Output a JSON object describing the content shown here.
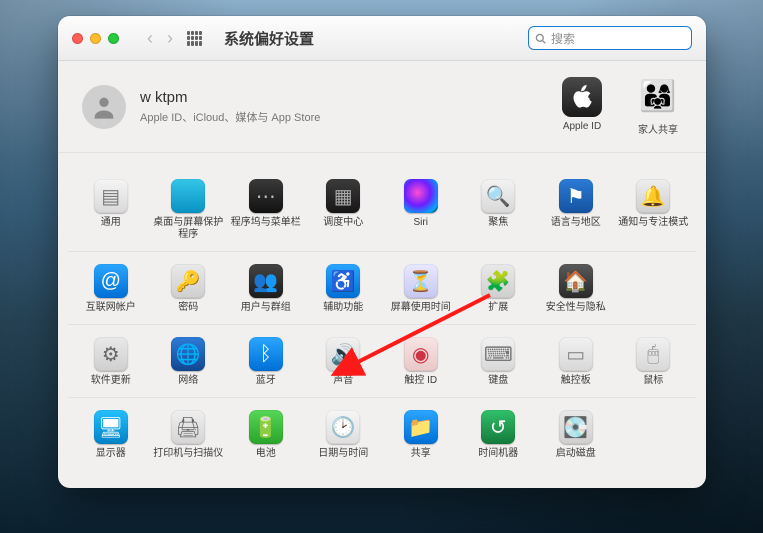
{
  "window": {
    "title": "系统偏好设置",
    "search_placeholder": "搜索"
  },
  "account": {
    "name": "w ktpm",
    "subtitle": "Apple ID、iCloud、媒体与 App Store",
    "right": [
      {
        "key": "apple-id",
        "label": "Apple ID"
      },
      {
        "key": "family",
        "label": "家人共享"
      }
    ]
  },
  "rows": [
    [
      {
        "key": "general",
        "label": "通用"
      },
      {
        "key": "desktop",
        "label": "桌面与屏幕保护程序"
      },
      {
        "key": "dock",
        "label": "程序坞与菜单栏"
      },
      {
        "key": "mission",
        "label": "调度中心"
      },
      {
        "key": "siri",
        "label": "Siri"
      },
      {
        "key": "spotlight",
        "label": "聚焦"
      },
      {
        "key": "language",
        "label": "语言与地区"
      },
      {
        "key": "notifications",
        "label": "通知与专注模式"
      }
    ],
    [
      {
        "key": "internet",
        "label": "互联网帐户"
      },
      {
        "key": "passwords",
        "label": "密码"
      },
      {
        "key": "users",
        "label": "用户与群组"
      },
      {
        "key": "accessibility",
        "label": "辅助功能"
      },
      {
        "key": "screentime",
        "label": "屏幕使用时间"
      },
      {
        "key": "extensions",
        "label": "扩展"
      },
      {
        "key": "security",
        "label": "安全性与隐私"
      },
      null
    ],
    [
      {
        "key": "update",
        "label": "软件更新"
      },
      {
        "key": "network",
        "label": "网络"
      },
      {
        "key": "bluetooth",
        "label": "蓝牙"
      },
      {
        "key": "sound",
        "label": "声音",
        "highlight": true
      },
      {
        "key": "touchid",
        "label": "触控 ID"
      },
      {
        "key": "keyboard",
        "label": "键盘"
      },
      {
        "key": "trackpad",
        "label": "触控板"
      },
      {
        "key": "mouse",
        "label": "鼠标"
      }
    ],
    [
      {
        "key": "displays",
        "label": "显示器"
      },
      {
        "key": "printers",
        "label": "打印机与扫描仪"
      },
      {
        "key": "battery",
        "label": "电池"
      },
      {
        "key": "datetime",
        "label": "日期与时间"
      },
      {
        "key": "sharing",
        "label": "共享"
      },
      {
        "key": "timemachine",
        "label": "时间机器"
      },
      {
        "key": "startupdisk",
        "label": "启动磁盘"
      },
      null
    ]
  ],
  "annotation": {
    "arrow_points_to": "sound"
  },
  "icon_styles": {
    "general": {
      "bg": "linear-gradient(#f5f5f5,#d9d9d9)",
      "glyph": "▤",
      "color": "#7a7a7a"
    },
    "desktop": {
      "bg": "linear-gradient(#34c6e8,#0892c4)",
      "glyph": "",
      "color": "#fff"
    },
    "dock": {
      "bg": "linear-gradient(#3a3a3a,#111)",
      "glyph": "⋯",
      "color": "#bbb"
    },
    "mission": {
      "bg": "linear-gradient(#3b3b3b,#161616)",
      "glyph": "▦",
      "color": "#aaa"
    },
    "siri": {
      "bg": "radial-gradient(circle at 40% 40%, #ff4dd2 0%, #6b1fff 45%, #0af 80%, #000 100%)",
      "glyph": "",
      "color": "#fff"
    },
    "spotlight": {
      "bg": "linear-gradient(#f3f3f3,#d8d8d8)",
      "glyph": "🔍",
      "color": "#555"
    },
    "language": {
      "bg": "linear-gradient(#2c7bd6,#1452a0)",
      "glyph": "⚑",
      "color": "#fff"
    },
    "notifications": {
      "bg": "linear-gradient(#eeeeee,#cfcfcf)",
      "glyph": "🔔",
      "color": "#c0392b"
    },
    "internet": {
      "bg": "linear-gradient(#2aa6ff,#006fd6)",
      "glyph": "@",
      "color": "#fff"
    },
    "passwords": {
      "bg": "linear-gradient(#e9e9e9,#cfcfcf)",
      "glyph": "🔑",
      "color": "#888"
    },
    "users": {
      "bg": "linear-gradient(#434343,#1c1c1c)",
      "glyph": "👥",
      "color": "#ddd"
    },
    "accessibility": {
      "bg": "linear-gradient(#2aa6ff,#006fd6)",
      "glyph": "♿",
      "color": "#fff"
    },
    "screentime": {
      "bg": "linear-gradient(#e8e8ff,#c8c8f0)",
      "glyph": "⏳",
      "color": "#5757aa"
    },
    "extensions": {
      "bg": "linear-gradient(#e9e9e9,#cfcfcf)",
      "glyph": "🧩",
      "color": "#888"
    },
    "security": {
      "bg": "linear-gradient(#5a5a5a,#2a2a2a)",
      "glyph": "🏠",
      "color": "#ddd"
    },
    "update": {
      "bg": "linear-gradient(#e9e9e9,#cfcfcf)",
      "glyph": "⚙︎",
      "color": "#666"
    },
    "network": {
      "bg": "linear-gradient(#2f7bd8,#10478f)",
      "glyph": "🌐",
      "color": "#fff"
    },
    "bluetooth": {
      "bg": "linear-gradient(#2aa6ff,#006fd6)",
      "glyph": "ᛒ",
      "color": "#fff"
    },
    "sound": {
      "bg": "linear-gradient(#f1f1f1,#d6d6d6)",
      "glyph": "🔊",
      "color": "#555"
    },
    "touchid": {
      "bg": "linear-gradient(#f8e4e4,#e9c8c8)",
      "glyph": "◉",
      "color": "#cc3344"
    },
    "keyboard": {
      "bg": "linear-gradient(#f1f1f1,#d8d8d8)",
      "glyph": "⌨︎",
      "color": "#777"
    },
    "trackpad": {
      "bg": "linear-gradient(#f1f1f1,#d8d8d8)",
      "glyph": "▭",
      "color": "#888"
    },
    "mouse": {
      "bg": "linear-gradient(#f1f1f1,#d8d8d8)",
      "glyph": "🖱",
      "color": "#888"
    },
    "displays": {
      "bg": "linear-gradient(#24c0ff,#0081c6)",
      "glyph": "🖥",
      "color": "#fff"
    },
    "printers": {
      "bg": "linear-gradient(#efefef,#d5d5d5)",
      "glyph": "🖨",
      "color": "#666"
    },
    "battery": {
      "bg": "linear-gradient(#57d657,#2aa52a)",
      "glyph": "🔋",
      "color": "#fff"
    },
    "datetime": {
      "bg": "linear-gradient(#f6f6f6,#dedede)",
      "glyph": "🕑",
      "color": "#555"
    },
    "sharing": {
      "bg": "linear-gradient(#2aa6ff,#006fd6)",
      "glyph": "📁",
      "color": "#fff"
    },
    "timemachine": {
      "bg": "linear-gradient(#31c069,#147a3b)",
      "glyph": "↺",
      "color": "#fff"
    },
    "startupdisk": {
      "bg": "linear-gradient(#e9e9e9,#cfcfcf)",
      "glyph": "💽",
      "color": "#777"
    }
  }
}
